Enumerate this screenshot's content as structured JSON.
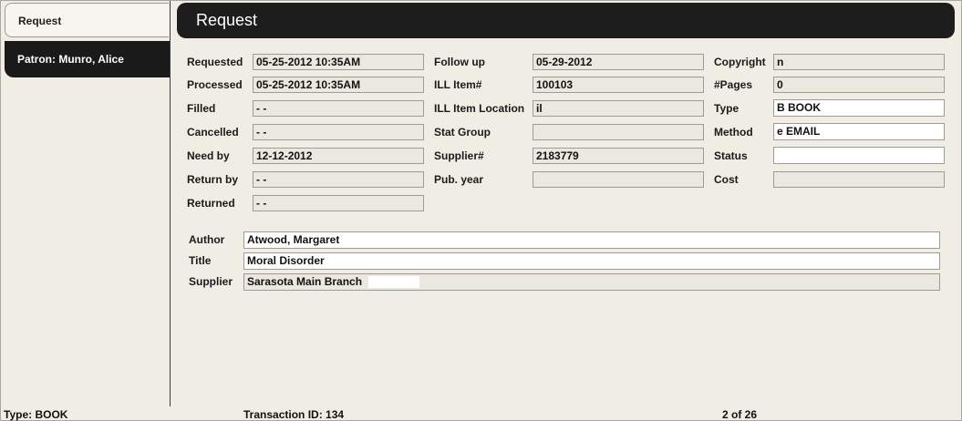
{
  "sidebar": {
    "request_tab": "Request",
    "patron_tab": "Patron: Munro, Alice"
  },
  "header": {
    "title": "Request"
  },
  "dates": {
    "requested_label": "Requested",
    "requested_value": "05-25-2012 10:35AM",
    "processed_label": "Processed",
    "processed_value": "05-25-2012 10:35AM",
    "filled_label": "Filled",
    "filled_value": "- -",
    "cancelled_label": "Cancelled",
    "cancelled_value": "- -",
    "needby_label": "Need by",
    "needby_value": "12-12-2012",
    "returnby_label": "Return by",
    "returnby_value": "- -",
    "returned_label": "Returned",
    "returned_value": "- -"
  },
  "ill": {
    "followup_label": "Follow up",
    "followup_value": "05-29-2012",
    "item_label": "ILL Item#",
    "item_value": "100103",
    "location_label": "ILL Item Location",
    "location_value": "il",
    "statgroup_label": "Stat Group",
    "statgroup_value": "",
    "supplier_label": "Supplier#",
    "supplier_value": "2183779",
    "pubyear_label": "Pub. year",
    "pubyear_value": ""
  },
  "misc": {
    "copyright_label": "Copyright",
    "copyright_value": "n",
    "pages_label": "#Pages",
    "pages_value": "0",
    "type_label": "Type",
    "type_value": "B  BOOK",
    "method_label": "Method",
    "method_value": "e  EMAIL",
    "status_label": "Status",
    "status_value": "",
    "cost_label": "Cost",
    "cost_value": ""
  },
  "biblio": {
    "author_label": "Author",
    "author_value": "Atwood, Margaret",
    "title_label": "Title",
    "title_value": "Moral Disorder",
    "supplier_label": "Supplier",
    "supplier_value": "Sarasota Main Branch"
  },
  "footer": {
    "type_text": "Type:  BOOK",
    "transaction_text": "Transaction ID:  134",
    "pager_text": "2 of 26"
  }
}
